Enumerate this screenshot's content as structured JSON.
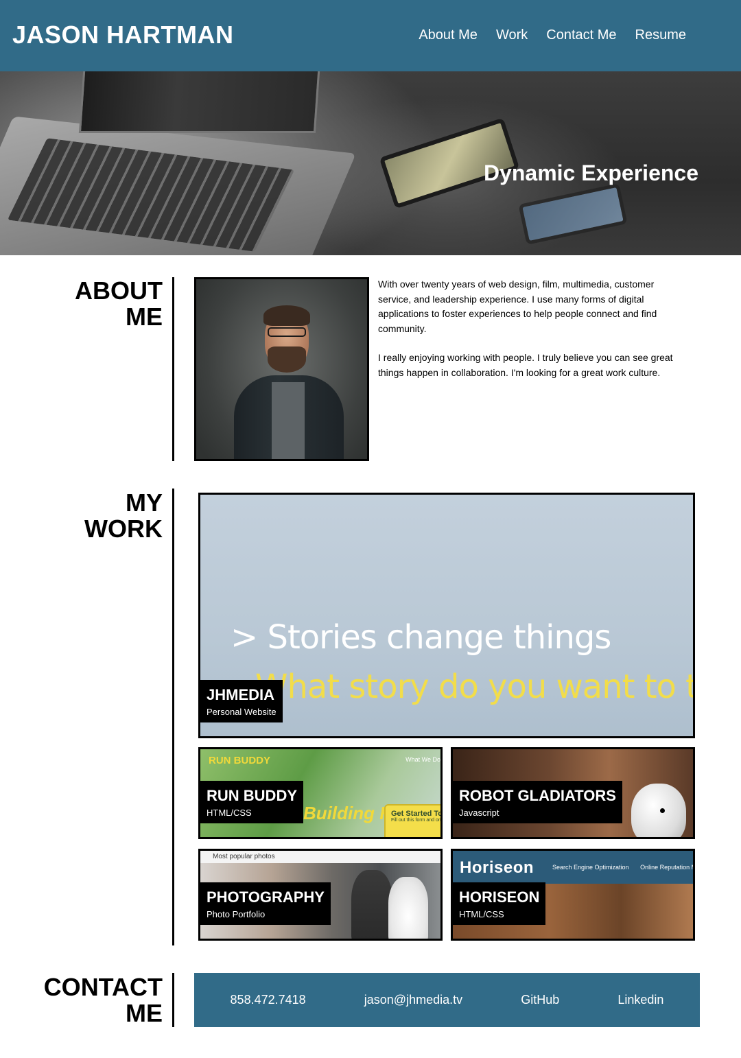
{
  "header": {
    "brand": "JASON HARTMAN",
    "nav": [
      "About Me",
      "Work",
      "Contact Me",
      "Resume"
    ]
  },
  "hero": {
    "title": "Dynamic Experience"
  },
  "about": {
    "title_line1": "ABOUT",
    "title_line2": "ME",
    "paragraphs": [
      "With over twenty years of web design, film, multimedia, customer service, and leadership experience. I use many forms of digital applications to foster experiences to help people connect and find community.",
      "I really enjoying working with people. I truly believe you can see great things happen in collaboration. I'm looking for a great work culture."
    ]
  },
  "work": {
    "title_line1": "MY",
    "title_line2": "WORK",
    "projects": [
      {
        "title": "JHMEDIA",
        "subtitle": "Personal Website",
        "screenshot_text": [
          "> Stories change things",
          "What story do you want to tell"
        ]
      },
      {
        "title": "RUN BUDDY",
        "subtitle": "HTML/CSS",
        "screenshot_text": [
          "RUN BUDDY",
          "What We Do",
          "Building Habits.",
          "Get Started Today",
          "Fill out this form and one of our trainers will schedule a consult"
        ]
      },
      {
        "title": "ROBOT GLADIATORS",
        "subtitle": "Javascript"
      },
      {
        "title": "PHOTOGRAPHY",
        "subtitle": "Photo Portfolio",
        "screenshot_text": [
          "Most popular photos"
        ]
      },
      {
        "title": "HORISEON",
        "subtitle": "HTML/CSS",
        "screenshot_text": [
          "Horiseon",
          "Search Engine Optimization",
          "Online Reputation Management"
        ]
      }
    ]
  },
  "contact": {
    "title_line1": "CONTACT",
    "title_line2": "ME",
    "links": [
      "858.472.7418",
      "jason@jhmedia.tv",
      "GitHub",
      "Linkedin"
    ]
  },
  "colors": {
    "primary": "#316b88",
    "label_bg": "#000000",
    "accent_yellow": "#f2dd4a"
  }
}
